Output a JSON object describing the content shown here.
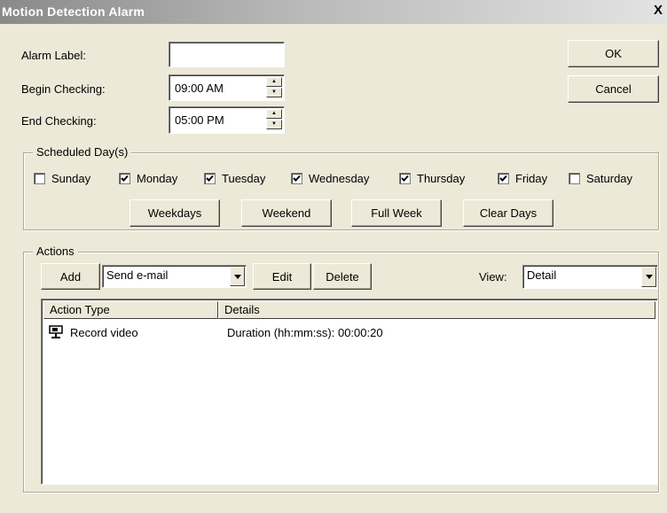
{
  "window": {
    "title": "Motion Detection Alarm",
    "close": "X"
  },
  "form": {
    "alarm_label": {
      "label": "Alarm Label:",
      "value": ""
    },
    "begin_checking": {
      "label": "Begin Checking:",
      "value": "09:00 AM"
    },
    "end_checking": {
      "label": "End Checking:",
      "value": "05:00 PM"
    }
  },
  "buttons": {
    "ok": "OK",
    "cancel": "Cancel"
  },
  "scheduled": {
    "legend": "Scheduled Day(s)",
    "days": [
      {
        "label": "Sunday",
        "checked": false
      },
      {
        "label": "Monday",
        "checked": true
      },
      {
        "label": "Tuesday",
        "checked": true
      },
      {
        "label": "Wednesday",
        "checked": true
      },
      {
        "label": "Thursday",
        "checked": true
      },
      {
        "label": "Friday",
        "checked": true
      },
      {
        "label": "Saturday",
        "checked": false
      }
    ],
    "presets": [
      "Weekdays",
      "Weekend",
      "Full Week",
      "Clear Days"
    ]
  },
  "actions": {
    "legend": "Actions",
    "add": "Add",
    "action_select": "Send e-mail",
    "edit": "Edit",
    "delete": "Delete",
    "view_label": "View:",
    "view_select": "Detail",
    "columns": [
      "Action Type",
      "Details"
    ],
    "rows": [
      {
        "type": "Record video",
        "details": "Duration (hh:mm:ss): 00:00:20",
        "icon": "camera-icon"
      }
    ]
  }
}
